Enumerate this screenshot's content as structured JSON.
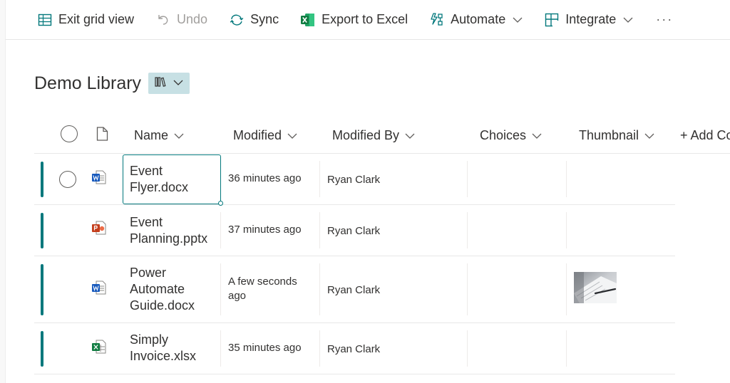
{
  "toolbar": {
    "exit_grid": "Exit grid view",
    "undo": "Undo",
    "sync": "Sync",
    "export": "Export to Excel",
    "automate": "Automate",
    "integrate": "Integrate",
    "more": "···"
  },
  "library": {
    "title": "Demo Library",
    "view_icon": "library-icon"
  },
  "columns": {
    "name": "Name",
    "modified": "Modified",
    "modified_by": "Modified By",
    "choices": "Choices",
    "thumbnail": "Thumbnail",
    "add_column": "+ Add Co"
  },
  "rows": [
    {
      "name_line1": "Event",
      "name_line2": "Flyer.docx",
      "name_line3": "",
      "modified": "36 minutes ago",
      "modified_line2": "",
      "modified_by": "Ryan Clark",
      "icon": "word-icon",
      "has_thumbnail": false
    },
    {
      "name_line1": "Event",
      "name_line2": "Planning.pptx",
      "name_line3": "",
      "modified": "37 minutes ago",
      "modified_line2": "",
      "modified_by": "Ryan Clark",
      "icon": "powerpoint-icon",
      "has_thumbnail": false
    },
    {
      "name_line1": "Power",
      "name_line2": "Automate",
      "name_line3": "Guide.docx",
      "modified": "A few seconds",
      "modified_line2": "ago",
      "modified_by": "Ryan Clark",
      "icon": "word-icon",
      "has_thumbnail": true
    },
    {
      "name_line1": "Simply",
      "name_line2": "Invoice.xlsx",
      "name_line3": "",
      "modified": "35 minutes ago",
      "modified_line2": "",
      "modified_by": "Ryan Clark",
      "icon": "excel-icon",
      "has_thumbnail": false
    }
  ],
  "colors": {
    "accent": "#03787c",
    "view_switch_bg": "#c7e0e4",
    "word": "#185abd",
    "powerpoint": "#c43e1c",
    "excel": "#107c41"
  }
}
